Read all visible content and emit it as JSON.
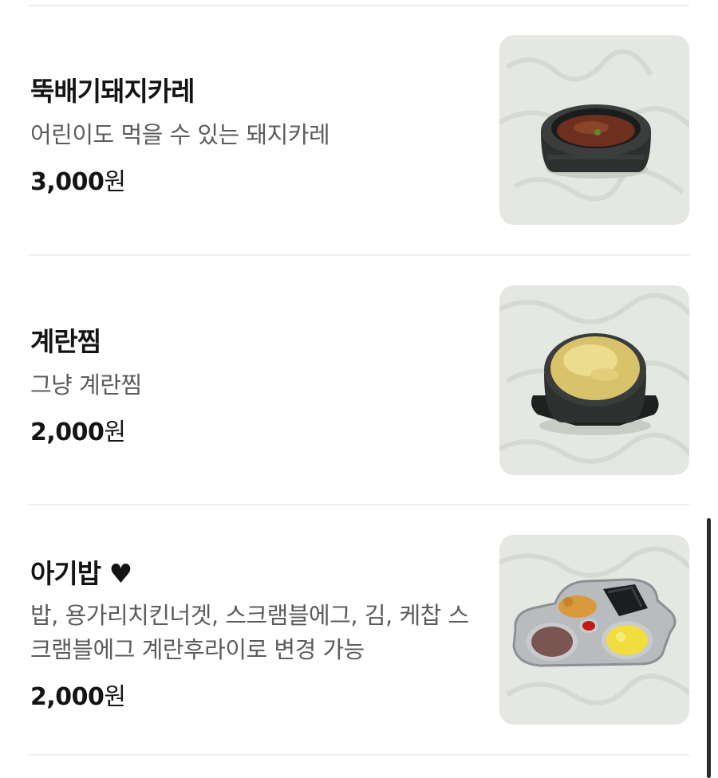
{
  "menu": {
    "items": [
      {
        "name": "뚝배기돼지카레",
        "description": "어린이도 먹을 수 있는 돼지카레",
        "price": "3,000",
        "currency": "원",
        "image": "pork-curry-photo"
      },
      {
        "name": "계란찜",
        "description": "그냥 계란찜",
        "price": "2,000",
        "currency": "원",
        "image": "steamed-egg-photo"
      },
      {
        "name": "아기밥 ♥",
        "description": "밥, 용가리치킨너겟, 스크램블에그, 김, 케찹 스크램블에그 계란후라이로 변경 가능",
        "price": "2,000",
        "currency": "원",
        "image": "kids-meal-photo"
      }
    ]
  },
  "colors": {
    "text_primary": "#141414",
    "text_secondary": "#5c5c5c",
    "divider": "#efefef",
    "photo_background": "#e4e7e2"
  }
}
